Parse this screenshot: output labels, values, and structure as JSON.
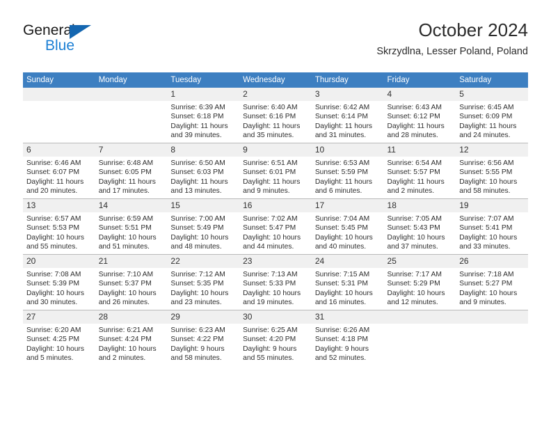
{
  "brand": {
    "name_part1": "General",
    "name_part2": "Blue",
    "triangle_color": "#1466b0",
    "blue_color": "#1b7fd4"
  },
  "header": {
    "title": "October 2024",
    "subtitle": "Skrzydlna, Lesser Poland, Poland"
  },
  "theme": {
    "header_bg": "#3d7fc1",
    "daynum_bg": "#f0f0f0",
    "cell_bg": "#ffffff",
    "grid_line": "#b9b9b9"
  },
  "weekday_headers": [
    "Sunday",
    "Monday",
    "Tuesday",
    "Wednesday",
    "Thursday",
    "Friday",
    "Saturday"
  ],
  "labels": {
    "sunrise_prefix": "Sunrise:",
    "sunset_prefix": "Sunset:",
    "daylight_prefix": "Daylight:"
  },
  "weeks": [
    [
      {
        "day": "",
        "sunrise": "",
        "sunset": "",
        "daylight_line1": "",
        "daylight_line2": ""
      },
      {
        "day": "",
        "sunrise": "",
        "sunset": "",
        "daylight_line1": "",
        "daylight_line2": ""
      },
      {
        "day": "1",
        "sunrise": "Sunrise: 6:39 AM",
        "sunset": "Sunset: 6:18 PM",
        "daylight_line1": "Daylight: 11 hours",
        "daylight_line2": "and 39 minutes."
      },
      {
        "day": "2",
        "sunrise": "Sunrise: 6:40 AM",
        "sunset": "Sunset: 6:16 PM",
        "daylight_line1": "Daylight: 11 hours",
        "daylight_line2": "and 35 minutes."
      },
      {
        "day": "3",
        "sunrise": "Sunrise: 6:42 AM",
        "sunset": "Sunset: 6:14 PM",
        "daylight_line1": "Daylight: 11 hours",
        "daylight_line2": "and 31 minutes."
      },
      {
        "day": "4",
        "sunrise": "Sunrise: 6:43 AM",
        "sunset": "Sunset: 6:12 PM",
        "daylight_line1": "Daylight: 11 hours",
        "daylight_line2": "and 28 minutes."
      },
      {
        "day": "5",
        "sunrise": "Sunrise: 6:45 AM",
        "sunset": "Sunset: 6:09 PM",
        "daylight_line1": "Daylight: 11 hours",
        "daylight_line2": "and 24 minutes."
      }
    ],
    [
      {
        "day": "6",
        "sunrise": "Sunrise: 6:46 AM",
        "sunset": "Sunset: 6:07 PM",
        "daylight_line1": "Daylight: 11 hours",
        "daylight_line2": "and 20 minutes."
      },
      {
        "day": "7",
        "sunrise": "Sunrise: 6:48 AM",
        "sunset": "Sunset: 6:05 PM",
        "daylight_line1": "Daylight: 11 hours",
        "daylight_line2": "and 17 minutes."
      },
      {
        "day": "8",
        "sunrise": "Sunrise: 6:50 AM",
        "sunset": "Sunset: 6:03 PM",
        "daylight_line1": "Daylight: 11 hours",
        "daylight_line2": "and 13 minutes."
      },
      {
        "day": "9",
        "sunrise": "Sunrise: 6:51 AM",
        "sunset": "Sunset: 6:01 PM",
        "daylight_line1": "Daylight: 11 hours",
        "daylight_line2": "and 9 minutes."
      },
      {
        "day": "10",
        "sunrise": "Sunrise: 6:53 AM",
        "sunset": "Sunset: 5:59 PM",
        "daylight_line1": "Daylight: 11 hours",
        "daylight_line2": "and 6 minutes."
      },
      {
        "day": "11",
        "sunrise": "Sunrise: 6:54 AM",
        "sunset": "Sunset: 5:57 PM",
        "daylight_line1": "Daylight: 11 hours",
        "daylight_line2": "and 2 minutes."
      },
      {
        "day": "12",
        "sunrise": "Sunrise: 6:56 AM",
        "sunset": "Sunset: 5:55 PM",
        "daylight_line1": "Daylight: 10 hours",
        "daylight_line2": "and 58 minutes."
      }
    ],
    [
      {
        "day": "13",
        "sunrise": "Sunrise: 6:57 AM",
        "sunset": "Sunset: 5:53 PM",
        "daylight_line1": "Daylight: 10 hours",
        "daylight_line2": "and 55 minutes."
      },
      {
        "day": "14",
        "sunrise": "Sunrise: 6:59 AM",
        "sunset": "Sunset: 5:51 PM",
        "daylight_line1": "Daylight: 10 hours",
        "daylight_line2": "and 51 minutes."
      },
      {
        "day": "15",
        "sunrise": "Sunrise: 7:00 AM",
        "sunset": "Sunset: 5:49 PM",
        "daylight_line1": "Daylight: 10 hours",
        "daylight_line2": "and 48 minutes."
      },
      {
        "day": "16",
        "sunrise": "Sunrise: 7:02 AM",
        "sunset": "Sunset: 5:47 PM",
        "daylight_line1": "Daylight: 10 hours",
        "daylight_line2": "and 44 minutes."
      },
      {
        "day": "17",
        "sunrise": "Sunrise: 7:04 AM",
        "sunset": "Sunset: 5:45 PM",
        "daylight_line1": "Daylight: 10 hours",
        "daylight_line2": "and 40 minutes."
      },
      {
        "day": "18",
        "sunrise": "Sunrise: 7:05 AM",
        "sunset": "Sunset: 5:43 PM",
        "daylight_line1": "Daylight: 10 hours",
        "daylight_line2": "and 37 minutes."
      },
      {
        "day": "19",
        "sunrise": "Sunrise: 7:07 AM",
        "sunset": "Sunset: 5:41 PM",
        "daylight_line1": "Daylight: 10 hours",
        "daylight_line2": "and 33 minutes."
      }
    ],
    [
      {
        "day": "20",
        "sunrise": "Sunrise: 7:08 AM",
        "sunset": "Sunset: 5:39 PM",
        "daylight_line1": "Daylight: 10 hours",
        "daylight_line2": "and 30 minutes."
      },
      {
        "day": "21",
        "sunrise": "Sunrise: 7:10 AM",
        "sunset": "Sunset: 5:37 PM",
        "daylight_line1": "Daylight: 10 hours",
        "daylight_line2": "and 26 minutes."
      },
      {
        "day": "22",
        "sunrise": "Sunrise: 7:12 AM",
        "sunset": "Sunset: 5:35 PM",
        "daylight_line1": "Daylight: 10 hours",
        "daylight_line2": "and 23 minutes."
      },
      {
        "day": "23",
        "sunrise": "Sunrise: 7:13 AM",
        "sunset": "Sunset: 5:33 PM",
        "daylight_line1": "Daylight: 10 hours",
        "daylight_line2": "and 19 minutes."
      },
      {
        "day": "24",
        "sunrise": "Sunrise: 7:15 AM",
        "sunset": "Sunset: 5:31 PM",
        "daylight_line1": "Daylight: 10 hours",
        "daylight_line2": "and 16 minutes."
      },
      {
        "day": "25",
        "sunrise": "Sunrise: 7:17 AM",
        "sunset": "Sunset: 5:29 PM",
        "daylight_line1": "Daylight: 10 hours",
        "daylight_line2": "and 12 minutes."
      },
      {
        "day": "26",
        "sunrise": "Sunrise: 7:18 AM",
        "sunset": "Sunset: 5:27 PM",
        "daylight_line1": "Daylight: 10 hours",
        "daylight_line2": "and 9 minutes."
      }
    ],
    [
      {
        "day": "27",
        "sunrise": "Sunrise: 6:20 AM",
        "sunset": "Sunset: 4:25 PM",
        "daylight_line1": "Daylight: 10 hours",
        "daylight_line2": "and 5 minutes."
      },
      {
        "day": "28",
        "sunrise": "Sunrise: 6:21 AM",
        "sunset": "Sunset: 4:24 PM",
        "daylight_line1": "Daylight: 10 hours",
        "daylight_line2": "and 2 minutes."
      },
      {
        "day": "29",
        "sunrise": "Sunrise: 6:23 AM",
        "sunset": "Sunset: 4:22 PM",
        "daylight_line1": "Daylight: 9 hours",
        "daylight_line2": "and 58 minutes."
      },
      {
        "day": "30",
        "sunrise": "Sunrise: 6:25 AM",
        "sunset": "Sunset: 4:20 PM",
        "daylight_line1": "Daylight: 9 hours",
        "daylight_line2": "and 55 minutes."
      },
      {
        "day": "31",
        "sunrise": "Sunrise: 6:26 AM",
        "sunset": "Sunset: 4:18 PM",
        "daylight_line1": "Daylight: 9 hours",
        "daylight_line2": "and 52 minutes."
      },
      {
        "day": "",
        "sunrise": "",
        "sunset": "",
        "daylight_line1": "",
        "daylight_line2": ""
      },
      {
        "day": "",
        "sunrise": "",
        "sunset": "",
        "daylight_line1": "",
        "daylight_line2": ""
      }
    ]
  ]
}
